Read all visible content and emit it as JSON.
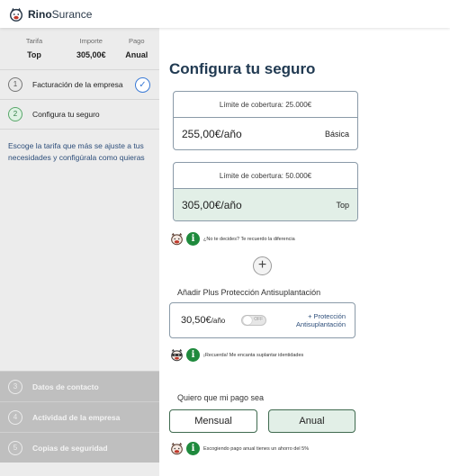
{
  "brand": {
    "name_bold": "Rino",
    "name_rest": "Surance"
  },
  "summary": {
    "cols": [
      {
        "label": "Tarifa",
        "value": "Top"
      },
      {
        "label": "Importe",
        "value": "305,00€"
      },
      {
        "label": "Pago",
        "value": "Anual"
      }
    ]
  },
  "steps": [
    {
      "num": "1",
      "label": "Facturación de la empresa",
      "done": true
    },
    {
      "num": "2",
      "label": "Configura tu seguro"
    },
    {
      "num": "3",
      "label": "Datos de contacto"
    },
    {
      "num": "4",
      "label": "Actividad de la empresa"
    },
    {
      "num": "5",
      "label": "Copias de seguridad"
    }
  ],
  "sidebar_note": "Escoge la tarifa que más se ajuste a tus necesidades y configúrala como quieras",
  "main": {
    "title": "Configura tu seguro",
    "plans": [
      {
        "limit": "Límite de cobertura: 25.000€",
        "price": "255,00€/año",
        "name": "Básica",
        "selected": false
      },
      {
        "limit": "Límite de cobertura: 50.000€",
        "price": "305,00€/año",
        "name": "Top",
        "selected": true
      }
    ],
    "hint1": "¿No te decides? Te recuerdo la diferencia",
    "addon_title": "Añadir Plus Protección Antisuplantación",
    "addon": {
      "price": "30,50€",
      "unit": "/año",
      "toggle": "OFF",
      "label": "+ Protección Antisuplantación"
    },
    "hint2": "¡Recuerda! Me encanta suplantar identidades",
    "pay_title": "Quiero que mi pago sea",
    "pay_options": {
      "monthly": "Mensual",
      "annual": "Anual"
    },
    "hint3": "Escogiendo pago anual tienes un ahorro del 5%"
  },
  "colors": {
    "accent_green": "#1f8a3d",
    "selected_bg": "#e2efe7",
    "link_blue": "#2d4e7a"
  }
}
